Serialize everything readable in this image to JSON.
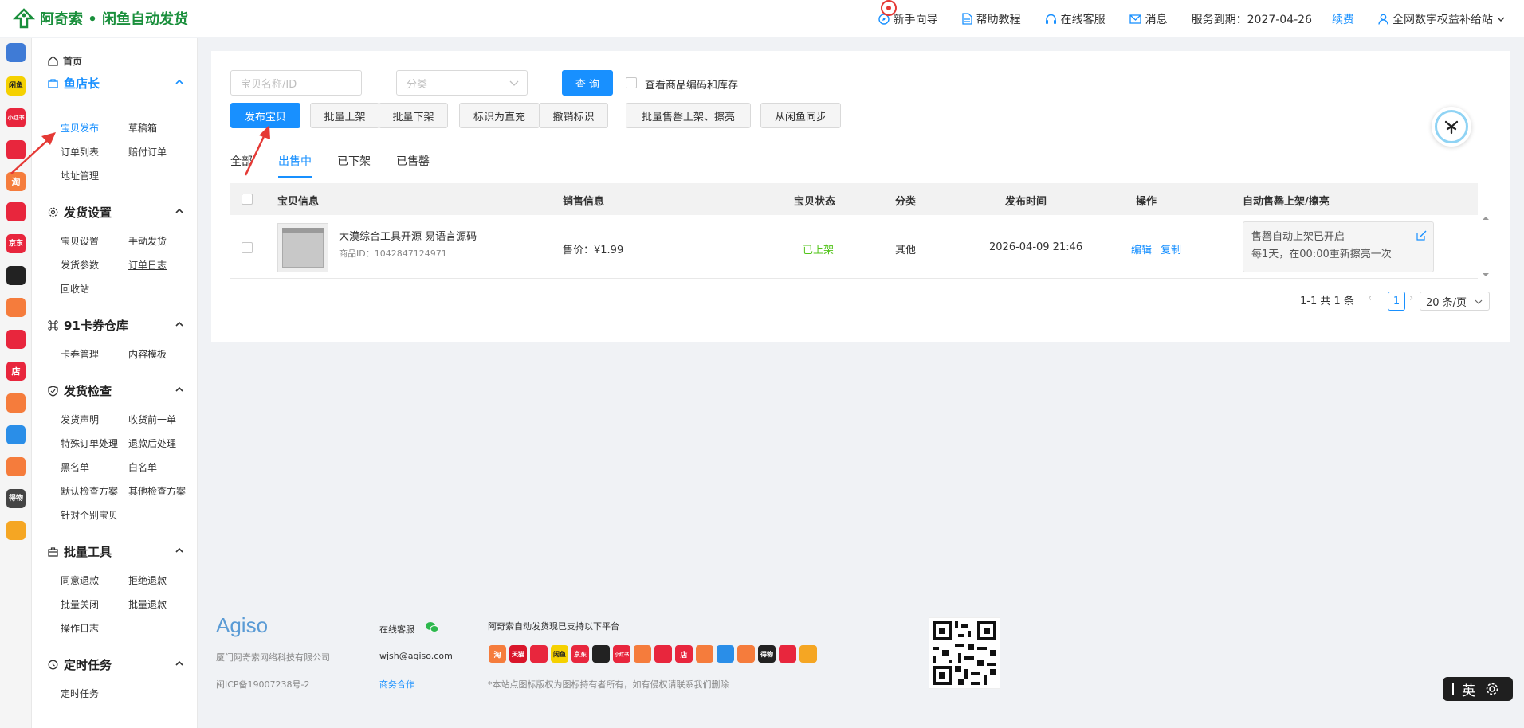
{
  "header": {
    "brand": "阿奇索 • 闲鱼自动发货",
    "newbie_guide": "新手向导",
    "help": "帮助教程",
    "service": "在线客服",
    "messages": "消息",
    "expiry_label": "服务到期：2027-04-26",
    "renew": "续费",
    "account": "全网数字权益补给站"
  },
  "rail_icons": [
    {
      "name": "grid",
      "label": "",
      "color": "#3f7bd6"
    },
    {
      "name": "xianyu",
      "label": "闲鱼",
      "color": "#f5d100"
    },
    {
      "name": "xiaohongshu",
      "label": "小红书",
      "color": "#e8263d"
    },
    {
      "name": "kuaishou",
      "label": "",
      "color": "#e8263d"
    },
    {
      "name": "taobao",
      "label": "淘",
      "color": "#f57c3c"
    },
    {
      "name": "pinduoduo",
      "label": "",
      "color": "#e8263d"
    },
    {
      "name": "jd",
      "label": "京东",
      "color": "#e8263d"
    },
    {
      "name": "douyin",
      "label": "",
      "color": "#222222"
    },
    {
      "name": "kuaishou2",
      "label": "",
      "color": "#f57c3c"
    },
    {
      "name": "thumb",
      "label": "",
      "color": "#e8263d"
    },
    {
      "name": "shop",
      "label": "店",
      "color": "#e8263d"
    },
    {
      "name": "weidian",
      "label": "",
      "color": "#f57c3c"
    },
    {
      "name": "link",
      "label": "",
      "color": "#2a8ee8"
    },
    {
      "name": "face",
      "label": "",
      "color": "#f57c3c"
    },
    {
      "name": "dewu",
      "label": "得物",
      "color": "#444444"
    },
    {
      "name": "tiger",
      "label": "",
      "color": "#f5a623"
    }
  ],
  "sidebar": {
    "home": "首页",
    "sections": [
      {
        "title": "鱼店长",
        "items": [
          "宝贝发布",
          "草稿箱",
          "订单列表",
          "赔付订单",
          "地址管理"
        ]
      },
      {
        "title": "发货设置",
        "items": [
          "宝贝设置",
          "手动发货",
          "发货参数",
          "订单日志",
          "回收站"
        ]
      },
      {
        "title": "91卡券仓库",
        "items": [
          "卡券管理",
          "内容模板"
        ]
      },
      {
        "title": "发货检查",
        "items": [
          "发货声明",
          "收货前一单",
          "特殊订单处理",
          "退款后处理",
          "黑名单",
          "白名单",
          "默认检查方案",
          "其他检查方案",
          "针对个别宝贝"
        ]
      },
      {
        "title": "批量工具",
        "items": [
          "同意退款",
          "拒绝退款",
          "批量关闭",
          "批量退款",
          "操作日志"
        ]
      },
      {
        "title": "定时任务",
        "items": [
          "定时任务"
        ]
      }
    ]
  },
  "toolbar": {
    "search_placeholder": "宝贝名称/ID",
    "category_placeholder": "分类",
    "query": "查 询",
    "show_code_label": "查看商品编码和库存",
    "publish": "发布宝贝",
    "batch_on": "批量上架",
    "batch_off": "批量下架",
    "mark_direct": "标识为直充",
    "unmark": "撤销标识",
    "batch_sold": "批量售罄上架、擦亮",
    "sync": "从闲鱼同步"
  },
  "tabs": [
    "全部",
    "出售中",
    "已下架",
    "已售罄"
  ],
  "active_tab": "出售中",
  "table": {
    "headers": [
      "宝贝信息",
      "销售信息",
      "宝贝状态",
      "分类",
      "发布时间",
      "操作",
      "自动售罄上架/擦亮"
    ],
    "rows": [
      {
        "title": "大漠综合工具开源 易语言源码",
        "product_id": "商品ID：1042847124971",
        "price": "售价：¥1.99",
        "status": "已上架",
        "category": "其他",
        "time": "2026-04-09 21:46",
        "edit": "编辑",
        "copy": "复制",
        "auto_line1": "售罄自动上架已开启",
        "auto_line2": "每1天，在00:00重新擦亮一次"
      }
    ]
  },
  "pagination": {
    "summary": "1-1 共 1 条",
    "current": "1",
    "page_size": "20 条/页"
  },
  "footer": {
    "brand": "Agiso",
    "company": "厦门阿奇索网络科技有限公司",
    "icp": "闽ICP备19007238号-2",
    "service_label": "在线客服",
    "email": "wjsh@agiso.com",
    "business": "商务合作",
    "platforms_title": "阿奇索自动发货现已支持以下平台",
    "copyright_note": "*本站点图标版权为图标持有者所有，如有侵权请联系我们删除",
    "platform_icons": [
      {
        "name": "taobao",
        "label": "淘",
        "color": "#f57c3c"
      },
      {
        "name": "tmall",
        "label": "天猫",
        "color": "#d9152a"
      },
      {
        "name": "pinduoduo",
        "label": "",
        "color": "#e8263d"
      },
      {
        "name": "xianyu",
        "label": "闲鱼",
        "color": "#f5d100"
      },
      {
        "name": "jd",
        "label": "京东",
        "color": "#e8263d"
      },
      {
        "name": "douyin",
        "label": "",
        "color": "#222222"
      },
      {
        "name": "xiaohongshu",
        "label": "小红书",
        "color": "#e8263d"
      },
      {
        "name": "kuaishou",
        "label": "",
        "color": "#f57c3c"
      },
      {
        "name": "thumb",
        "label": "",
        "color": "#e8263d"
      },
      {
        "name": "shop",
        "label": "店",
        "color": "#e8263d"
      },
      {
        "name": "weidian",
        "label": "",
        "color": "#f57c3c"
      },
      {
        "name": "link",
        "label": "",
        "color": "#2a8ee8"
      },
      {
        "name": "face",
        "label": "",
        "color": "#f57c3c"
      },
      {
        "name": "dewu",
        "label": "得物",
        "color": "#222222"
      },
      {
        "name": "kuaishou2",
        "label": "",
        "color": "#e8263d"
      },
      {
        "name": "tiger",
        "label": "",
        "color": "#f5a623"
      }
    ]
  },
  "ime": {
    "label": "英"
  },
  "colors": {
    "accent": "#1890ff",
    "brand_green": "#1a8f3c",
    "status_green": "#52c41a",
    "annotation_red": "#e53935"
  }
}
